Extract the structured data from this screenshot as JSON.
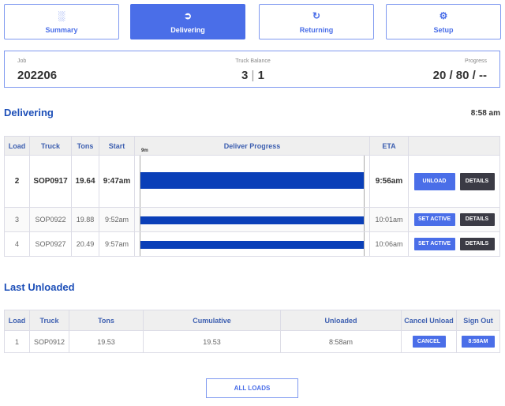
{
  "tabs": [
    {
      "label": "Summary",
      "icon": "bar-chart-icon"
    },
    {
      "label": "Delivering",
      "icon": "arrow-circle-icon",
      "active": true
    },
    {
      "label": "Returning",
      "icon": "return-icon"
    },
    {
      "label": "Setup",
      "icon": "gear-icon"
    }
  ],
  "info": {
    "job_label": "Job",
    "job": "202206",
    "balance_label": "Truck Balance",
    "balance_a": "3",
    "balance_sep": "|",
    "balance_b": "1",
    "progress_label": "Progress",
    "progress": "20 / 80 / --"
  },
  "delivering": {
    "title": "Delivering",
    "time": "8:58 am",
    "headers": {
      "load": "Load",
      "truck": "Truck",
      "tons": "Tons",
      "start": "Start",
      "progress": "Deliver Progress",
      "scale": "9m",
      "eta": "ETA"
    },
    "rows": [
      {
        "load": "2",
        "truck": "SOP0917",
        "tons": "19.64",
        "start": "9:47am",
        "progress": 1.0,
        "eta": "9:56am",
        "action": "UNLOAD",
        "details": "DETAILS"
      },
      {
        "load": "3",
        "truck": "SOP0922",
        "tons": "19.88",
        "start": "9:52am",
        "progress": 1.0,
        "eta": "10:01am",
        "action": "SET ACTIVE",
        "details": "DETAILS"
      },
      {
        "load": "4",
        "truck": "SOP0927",
        "tons": "20.49",
        "start": "9:57am",
        "progress": 1.0,
        "eta": "10:06am",
        "action": "SET ACTIVE",
        "details": "DETAILS"
      }
    ]
  },
  "last_unloaded": {
    "title": "Last Unloaded",
    "headers": {
      "load": "Load",
      "truck": "Truck",
      "tons": "Tons",
      "cumulative": "Cumulative",
      "unloaded": "Unloaded",
      "cancel": "Cancel Unload",
      "signout": "Sign Out"
    },
    "rows": [
      {
        "load": "1",
        "truck": "SOP0912",
        "tons": "19.53",
        "cumulative": "19.53",
        "unloaded": "8:58am",
        "cancel": "CANCEL",
        "signout": "8:58AM"
      }
    ]
  },
  "all_loads": "ALL LOADS"
}
